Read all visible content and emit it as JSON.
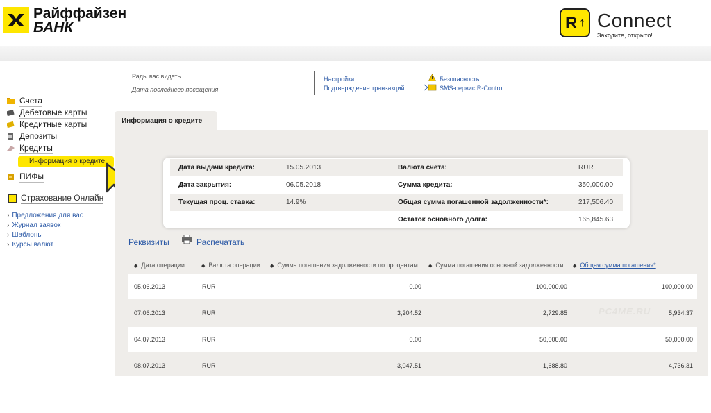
{
  "bank": {
    "name_line1": "Райффайзен",
    "name_line2": "БАНК"
  },
  "rconnect": {
    "badge": "R",
    "title": "Connect",
    "slogan": "Заходите, открыто!"
  },
  "welcome": {
    "greeting": "Рады вас видеть",
    "last_visit": "Дата последнего посещения"
  },
  "top_links": {
    "settings": "Настройки",
    "confirm": "Подтверждение транзакций",
    "security": "Безопасность",
    "sms": "SMS-сервис R-Control"
  },
  "sidebar": {
    "items": [
      {
        "label": "Счета",
        "icon": "folder-icon"
      },
      {
        "label": "Дебетовые карты",
        "icon": "card-icon"
      },
      {
        "label": "Кредитные карты",
        "icon": "credit-card-icon"
      },
      {
        "label": "Депозиты",
        "icon": "deposit-icon"
      },
      {
        "label": "Кредиты",
        "icon": "loan-icon"
      },
      {
        "label": "ПИФы",
        "icon": "fund-icon"
      }
    ],
    "active_sub": "Информация о кредите",
    "insurance": "Страхование Онлайн",
    "links": [
      "Предложения для вас",
      "Журнал заявок",
      "Шаблоны",
      "Курсы валют"
    ]
  },
  "tab": {
    "label": "Информация о кредите"
  },
  "loan": {
    "rows": [
      {
        "k1": "Дата выдачи кредита:",
        "v1": "15.05.2013",
        "k2": "Валюта счета:",
        "v2": "RUR"
      },
      {
        "k1": "Дата закрытия:",
        "v1": "06.05.2018",
        "k2": "Сумма кредита:",
        "v2": "350,000.00"
      },
      {
        "k1": "Текущая проц. ставка:",
        "v1": "14.9%",
        "k2": "Общая сумма погашенной задолженности*:",
        "v2": "217,506.40"
      },
      {
        "k1": "",
        "v1": "",
        "k2": "Остаток основного долга:",
        "v2": "165,845.63"
      }
    ]
  },
  "actions": {
    "requisites": "Реквизиты",
    "print": "Распечатать"
  },
  "table": {
    "headers": [
      "Дата операции",
      "Валюта операции",
      "Сумма погашения задолженности по процентам",
      "Сумма погашения основной задолженности",
      "Общая сумма погашения*"
    ],
    "rows": [
      [
        "05.06.2013",
        "RUR",
        "0.00",
        "100,000.00",
        "100,000.00"
      ],
      [
        "07.06.2013",
        "RUR",
        "3,204.52",
        "2,729.85",
        "5,934.37"
      ],
      [
        "04.07.2013",
        "RUR",
        "0.00",
        "50,000.00",
        "50,000.00"
      ],
      [
        "08.07.2013",
        "RUR",
        "3,047.51",
        "1,688.80",
        "4,736.31"
      ]
    ]
  },
  "watermark": "PC4ME.RU",
  "colors": {
    "brand_yellow": "#fee600",
    "link_blue": "#2b59a6",
    "panel_bg": "#efedea"
  }
}
